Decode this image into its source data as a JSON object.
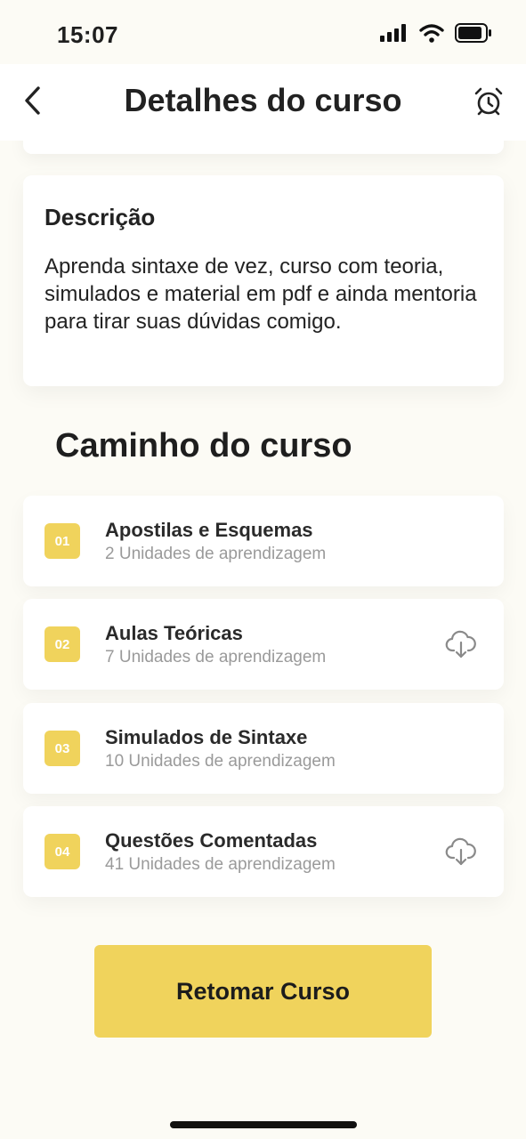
{
  "status_bar": {
    "time": "15:07",
    "icons": [
      "signal-icon",
      "wifi-icon",
      "battery-icon"
    ]
  },
  "header": {
    "title": "Detalhes do curso",
    "back_icon": "chevron-left-icon",
    "alarm_icon": "alarm-clock-icon"
  },
  "description": {
    "title": "Descrição",
    "text": "Aprenda sintaxe de vez, curso com teoria, simulados e material em pdf e ainda mentoria para tirar suas dúvidas comigo."
  },
  "course_path": {
    "title": "Caminho do curso",
    "modules": [
      {
        "number": "01",
        "title": "Apostilas e Esquemas",
        "subtitle": "2 Unidades de aprendizagem",
        "downloadable": false
      },
      {
        "number": "02",
        "title": "Aulas Teóricas",
        "subtitle": "7 Unidades de aprendizagem",
        "downloadable": true
      },
      {
        "number": "03",
        "title": "Simulados de Sintaxe",
        "subtitle": "10 Unidades de aprendizagem",
        "downloadable": false
      },
      {
        "number": "04",
        "title": "Questões Comentadas",
        "subtitle": "41 Unidades de aprendizagem",
        "downloadable": true
      }
    ]
  },
  "actions": {
    "resume_label": "Retomar Curso"
  },
  "colors": {
    "accent": "#f0d35c",
    "background": "#fcfbf5",
    "card": "#ffffff",
    "muted_text": "#9a9a9a"
  }
}
